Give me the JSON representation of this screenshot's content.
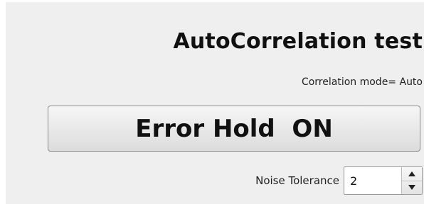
{
  "header": {
    "title": "AutoCorrelation test",
    "mode_text": "Correlation mode= Auto"
  },
  "error_hold": {
    "label": "Error Hold  ON"
  },
  "noise_tolerance": {
    "label": "Noise Tolerance",
    "value": "2"
  },
  "colors": {
    "panel_background": "#efefef",
    "text": "#111111"
  },
  "icons": {
    "spin_up": "triangle-up-icon",
    "spin_down": "triangle-down-icon"
  }
}
